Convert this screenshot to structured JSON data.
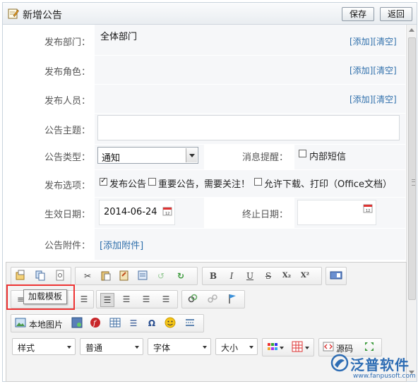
{
  "window": {
    "title": "新增公告",
    "save_label": "保存",
    "back_label": "返回"
  },
  "form": {
    "dept": {
      "label": "发布部门：",
      "value": "全体部门",
      "actions": "[添加][清空]"
    },
    "role": {
      "label": "发布角色：",
      "actions": "[添加][清空]"
    },
    "person": {
      "label": "发布人员：",
      "actions": "[添加][清空]"
    },
    "subject": {
      "label": "公告主题：",
      "value": ""
    },
    "type": {
      "label": "公告类型：",
      "selected": "通知"
    },
    "reminder": {
      "label": "消息提醒：",
      "option": "内部短信",
      "checked": false
    },
    "options": {
      "label": "发布选项：",
      "items": [
        {
          "text": "发布公告",
          "checked": true
        },
        {
          "text": "重要公告，需要关注！",
          "checked": false
        },
        {
          "text": "允许下载、打印（Office文档）",
          "checked": false
        }
      ]
    },
    "start_date": {
      "label": "生效日期：",
      "value": "2014-06-24"
    },
    "end_date": {
      "label": "终止日期：",
      "value": ""
    },
    "attachment": {
      "label": "公告附件：",
      "link": "[添加附件]"
    }
  },
  "editor": {
    "tooltip": "加载模板",
    "local_image_label": "本地图片",
    "source_label": "源码",
    "combos": {
      "style": "样式",
      "format": "普通",
      "font": "字体",
      "size": "大小"
    },
    "icons": {
      "row1": [
        "new-doc-icon",
        "copy-doc-icon",
        "preview-icon",
        "cut-icon",
        "paste-icon",
        "paste-word-icon",
        "paste-text-icon",
        "undo-icon",
        "redo-icon",
        "bold-icon",
        "italic-icon",
        "underline-icon",
        "strike-icon",
        "subscript-icon",
        "superscript-icon",
        "remove-format-icon"
      ],
      "bold": "B",
      "italic": "I",
      "underline": "U",
      "strike": "S",
      "sub": "X₂",
      "sup": "X²"
    }
  },
  "watermark": {
    "name": "泛普软件",
    "url": "www.fanpusoft.com"
  }
}
